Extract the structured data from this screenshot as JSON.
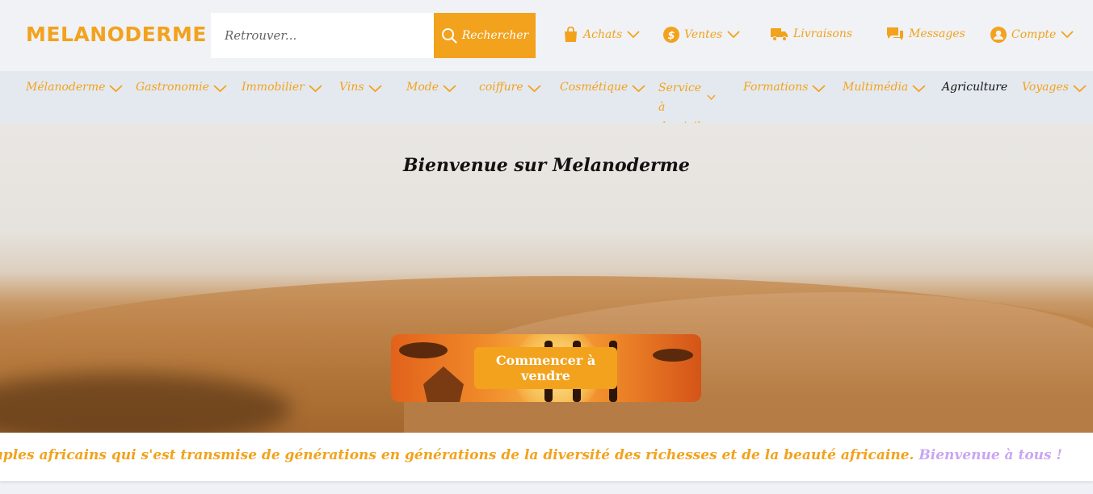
{
  "brand": {
    "name": "MELANODERME"
  },
  "search": {
    "placeholder": "Retrouver...",
    "button_label": "Rechercher"
  },
  "top_nav": [
    {
      "label": "Achats",
      "icon": "shopping-bag-icon",
      "dropdown": true
    },
    {
      "label": "Ventes",
      "icon": "dollar-circle-icon",
      "dropdown": true
    },
    {
      "label": "Livraisons",
      "icon": "truck-icon",
      "dropdown": false
    },
    {
      "label": "Messages",
      "icon": "comments-icon",
      "dropdown": false
    },
    {
      "label": "Compte",
      "icon": "user-circle-icon",
      "dropdown": true
    }
  ],
  "categories": [
    {
      "label": "Mélanoderme",
      "dropdown": true
    },
    {
      "label": "Gastronomie",
      "dropdown": true
    },
    {
      "label": "Immobilier",
      "dropdown": true
    },
    {
      "label": "Vins",
      "dropdown": true
    },
    {
      "label": "Mode",
      "dropdown": true
    },
    {
      "label": "coiffure",
      "dropdown": true
    },
    {
      "label": "Cosmétique",
      "dropdown": true
    },
    {
      "label": "Service à domicile",
      "dropdown": true
    },
    {
      "label": "Formations",
      "dropdown": true
    },
    {
      "label": "Multimédia",
      "dropdown": true
    },
    {
      "label": "Agriculture",
      "dropdown": false
    },
    {
      "label": "Voyages",
      "dropdown": true
    }
  ],
  "hero": {
    "title": "Bienvenue sur Melanoderme",
    "cta_label": "Commencer à vendre"
  },
  "marquee": {
    "text": "DERME représente l'histoire des peuples africains qui s'est transmise de générations en générations de la diversité des richesses et de la beauté africaine.",
    "welcome": "Bienvenue à tous !"
  },
  "colors": {
    "accent": "#f2a21d",
    "welcome": "#c9a6f2",
    "topbar_bg": "#f0f2f5",
    "catbar_bg": "#e4e9ef"
  }
}
